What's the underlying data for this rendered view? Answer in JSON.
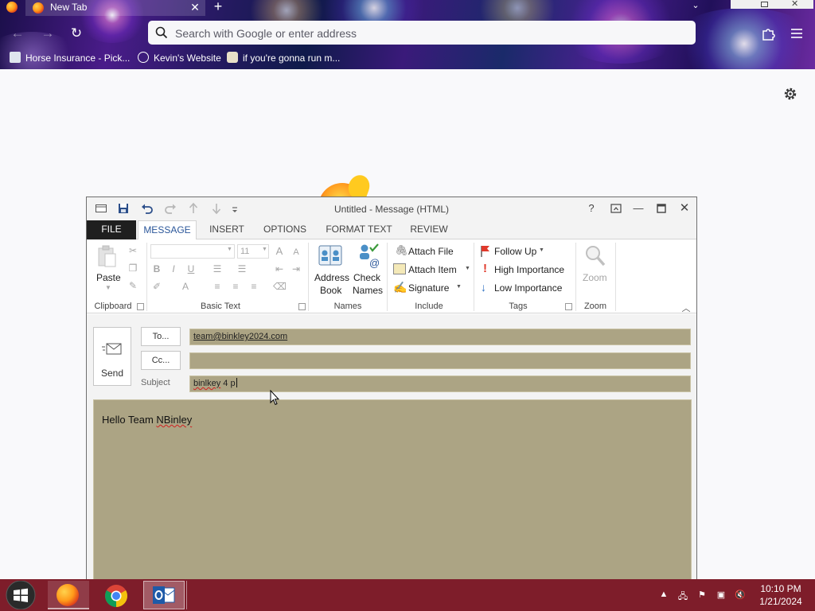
{
  "browser": {
    "tab": {
      "title": "New Tab"
    },
    "urlbar": {
      "placeholder": "Search with Google or enter address"
    },
    "bookmarks": [
      {
        "label": "Horse Insurance - Pick..."
      },
      {
        "label": "Kevin's Website"
      },
      {
        "label": "if you're gonna run m..."
      }
    ]
  },
  "outlook": {
    "window_title": "Untitled - Message (HTML)",
    "titlebar_help": "?",
    "ribbon_tabs": [
      "FILE",
      "MESSAGE",
      "INSERT",
      "OPTIONS",
      "FORMAT TEXT",
      "REVIEW"
    ],
    "groups": {
      "clipboard": {
        "label": "Clipboard",
        "paste": "Paste"
      },
      "basic_text": {
        "label": "Basic Text",
        "font_size": "11",
        "bold": "B",
        "italic": "I",
        "underline": "U",
        "font_color": "A"
      },
      "names": {
        "label": "Names",
        "address_book_1": "Address",
        "address_book_2": "Book",
        "check_names_1": "Check",
        "check_names_2": "Names"
      },
      "include": {
        "label": "Include",
        "attach_file": "Attach File",
        "attach_item": "Attach Item",
        "signature": "Signature"
      },
      "tags": {
        "label": "Tags",
        "follow_up": "Follow Up",
        "high_importance": "High Importance",
        "low_importance": "Low Importance"
      },
      "zoom": {
        "label": "Zoom",
        "zoom": "Zoom"
      }
    },
    "compose": {
      "send_label": "Send",
      "to_button": "To...",
      "cc_button": "Cc...",
      "subject_label": "Subject",
      "to_value": "team@binkley2024.com",
      "cc_value": "",
      "subject_prefix": "binlkey",
      "subject_rest": " 4 p",
      "body_greeting": "Hello Team ",
      "body_name": "NBinley"
    }
  },
  "taskbar": {
    "clock_time": "10:10 PM",
    "clock_date": "1/21/2024"
  },
  "colors": {
    "compose_field_bg": "#aca484",
    "taskbar_bg": "#7e1d2a",
    "outlook_accent": "#2b579a"
  }
}
